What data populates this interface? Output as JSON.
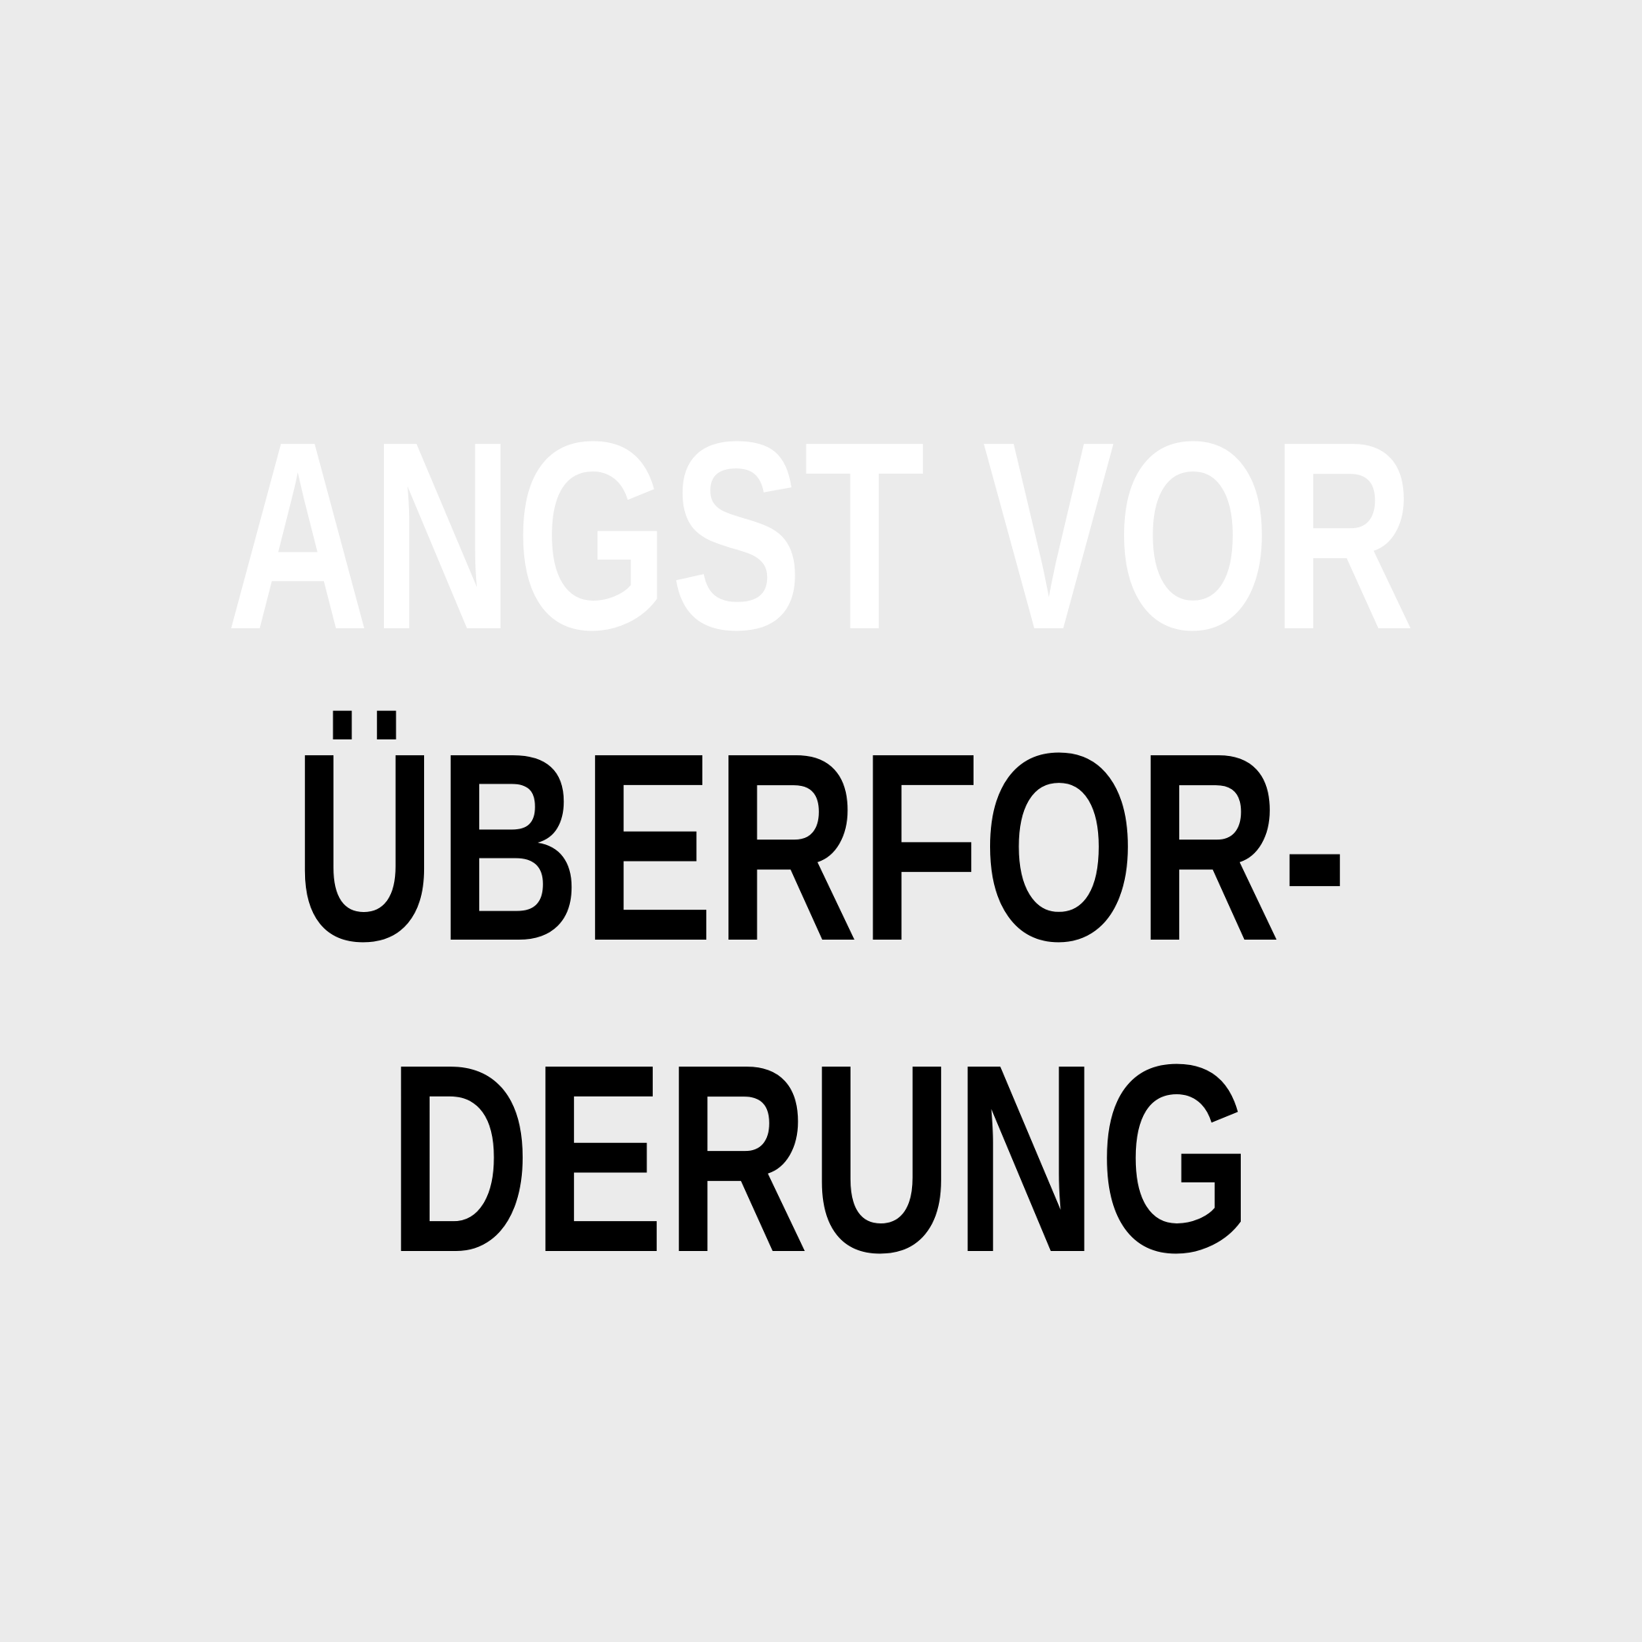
{
  "headline": {
    "line1": "ANGST VOR",
    "line2": "ÜBERFOR-",
    "line3": "DERUNG"
  },
  "colors": {
    "background": "#ebebeb",
    "highlight_text": "#ffffff",
    "primary_text": "#000000"
  }
}
